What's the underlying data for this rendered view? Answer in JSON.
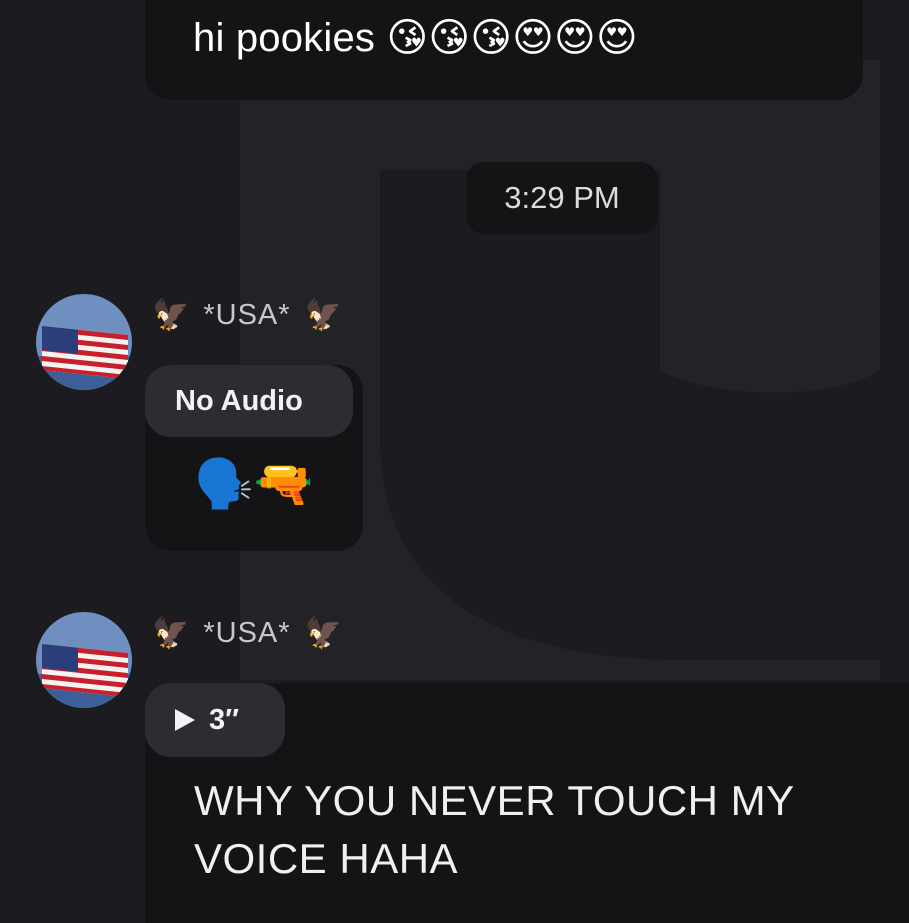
{
  "messages": {
    "top": {
      "text": "hi pookies",
      "emojis": "😘😘😘😍😍😍"
    },
    "timestamp": "3:29 PM",
    "first": {
      "sender": {
        "eagle_left": "🦅",
        "name": "*USA*",
        "eagle_right": "🦅"
      },
      "reply_label": "No Audio",
      "body_emojis": "🗣️🔫"
    },
    "second": {
      "sender": {
        "eagle_left": "🦅",
        "name": "*USA*",
        "eagle_right": "🦅"
      },
      "voice_duration": "3″",
      "body_line1": "WHY YOU NEVER TOUCH MY",
      "body_line2": "VOICE HAHA"
    }
  },
  "colors": {
    "background": "#1c1c20",
    "bubble": "#141417",
    "reply_pill": "#2c2c33",
    "text": "#ffffff"
  },
  "icons": [
    "eagle-emoji",
    "flag-avatar",
    "play-icon"
  ]
}
